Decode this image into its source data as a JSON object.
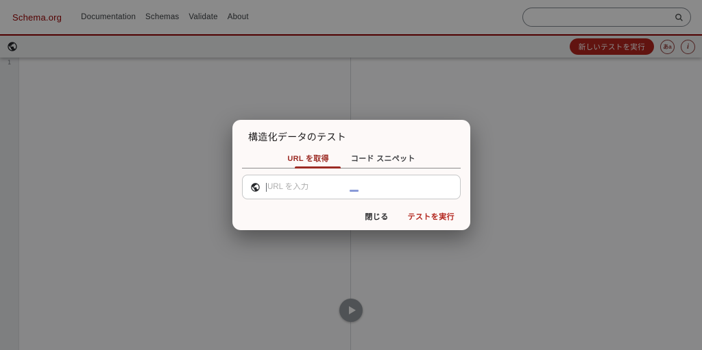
{
  "header": {
    "logo": "Schema.org",
    "nav": [
      {
        "label": "Documentation"
      },
      {
        "label": "Schemas"
      },
      {
        "label": "Validate"
      },
      {
        "label": "About"
      }
    ],
    "search": {
      "value": "",
      "placeholder": ""
    }
  },
  "toolbar": {
    "new_test_button": "新しいテストを実行",
    "language_badge": "あa",
    "info_glyph": "i"
  },
  "editor": {
    "line_number": "1"
  },
  "modal": {
    "title": "構造化データのテスト",
    "tabs": [
      {
        "label": "URL を取得",
        "active": true
      },
      {
        "label": "コード スニペット",
        "active": false
      }
    ],
    "input": {
      "value": "",
      "placeholder": "URL を入力"
    },
    "close_label": "閉じる",
    "run_label": "テストを実行"
  },
  "colors": {
    "brand_red": "#990001",
    "button_red": "#b3261e",
    "active_tab_red": "#9c2b24",
    "scrim": "rgba(0,0,0,0.46)",
    "modal_surface": "#fdf9f8",
    "ime_dash_blue": "#8a9ad8"
  }
}
